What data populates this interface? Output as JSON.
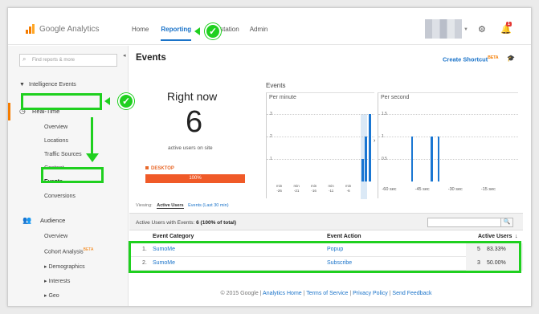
{
  "app": {
    "logo_text": "Google Analytics"
  },
  "nav": {
    "items": [
      "Home",
      "Reporting",
      "Customization",
      "Admin"
    ],
    "active": "Reporting",
    "visible_customization_text": "station"
  },
  "topbar": {
    "notification_count": "1"
  },
  "sidebar": {
    "search_placeholder": "Find reports & more",
    "items": {
      "intelligence": "Intelligence Events",
      "realtime": "Real-Time",
      "overview": "Overview",
      "locations": "Locations",
      "traffic": "Traffic Sources",
      "content": "Content",
      "events": "Events",
      "conversions": "Conversions",
      "audience": "Audience",
      "aud_overview": "Overview",
      "cohort": "Cohort Analysis",
      "cohort_badge": "BETA",
      "demographics": "Demographics",
      "interests": "Interests",
      "geo": "Geo"
    }
  },
  "main": {
    "title": "Events",
    "shortcut": "Create Shortcut",
    "shortcut_badge": "BETA",
    "right_now": {
      "title": "Right now",
      "value": "6",
      "subtitle": "active users on site",
      "device_label": "DESKTOP",
      "device_percent": "100%"
    },
    "events_title": "Events",
    "per_minute_label": "Per minute",
    "per_second_label": "Per second",
    "viewing": {
      "label": "Viewing:",
      "active": "Active Users",
      "other": "Events (Last 30 min)"
    },
    "summary": {
      "prefix": "Active Users with Events:",
      "value": "6 (100% of total)"
    },
    "table": {
      "headers": [
        "Event Category",
        "Event Action",
        "Active Users"
      ],
      "rows": [
        {
          "num": "1.",
          "category": "SumoMe",
          "action": "Popup",
          "users": "5",
          "percent": "83.33%"
        },
        {
          "num": "2.",
          "category": "SumoMe",
          "action": "Subscribe",
          "users": "3",
          "percent": "50.00%"
        }
      ]
    },
    "footer": {
      "copyright": "© 2015 Google",
      "links": [
        "Analytics Home",
        "Terms of Service",
        "Privacy Policy",
        "Send Feedback"
      ]
    }
  },
  "chart_data": [
    {
      "type": "bar",
      "title": "Per minute",
      "ylim": [
        0,
        3
      ],
      "y_ticks": [
        "1",
        "2",
        "3"
      ],
      "categories": [
        "-26",
        "-21",
        "-16",
        "-11",
        "-6"
      ],
      "x_tick_prefix": "min",
      "values": [
        0,
        0,
        0,
        0,
        0,
        0,
        0,
        0,
        0,
        0,
        0,
        0,
        0,
        0,
        0,
        0,
        0,
        0,
        0,
        0,
        0,
        0,
        0,
        0,
        0,
        0,
        0,
        1,
        2,
        3
      ]
    },
    {
      "type": "bar",
      "title": "Per second",
      "ylim": [
        0,
        1.5
      ],
      "y_ticks": [
        "0.5",
        "1",
        "1.5"
      ],
      "categories": [
        "-60 sec",
        "-45 sec",
        "-30 sec",
        "-15 sec"
      ],
      "x_seconds": [
        -49,
        -40,
        -37
      ],
      "values": [
        1,
        1,
        1
      ]
    }
  ],
  "colors": {
    "accent": "#1a73c9",
    "orange": "#f05a28",
    "highlight": "#1fd01f"
  },
  "icons": [
    "search-icon",
    "settings-gear-icon",
    "notification-bell-icon",
    "realtime-clock-icon",
    "audience-people-icon",
    "collapse-arrow-icon",
    "graduation-cap-icon",
    "checkmark-icon",
    "down-arrow-icon"
  ]
}
